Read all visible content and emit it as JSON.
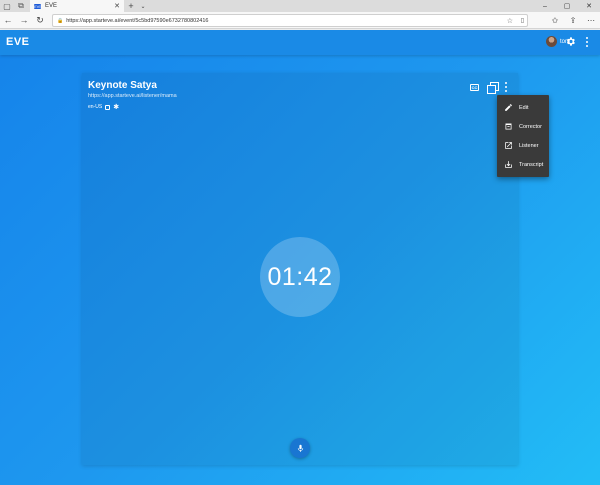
{
  "browser": {
    "tab_title": "EVE",
    "tab_favicon_text": "EVE",
    "url": "https://app.starteve.ai/event/5c5bd97590e6732780802416"
  },
  "app": {
    "logo": "EVE",
    "user_name": "tom"
  },
  "event": {
    "title": "Keynote Satya",
    "listener_url": "https://app.starteve.ai/listener/mama",
    "language": "en-US"
  },
  "timer": "01:42",
  "menu": {
    "items": [
      {
        "label": "Edit",
        "icon": "pencil-icon"
      },
      {
        "label": "Corrector",
        "icon": "corrector-icon"
      },
      {
        "label": "Listener",
        "icon": "open-external-icon"
      },
      {
        "label": "Transcript",
        "icon": "download-icon"
      }
    ]
  },
  "colors": {
    "appbar": "#1a8ae6",
    "menu_bg": "#3a3a3a",
    "mic": "#1976d2"
  }
}
